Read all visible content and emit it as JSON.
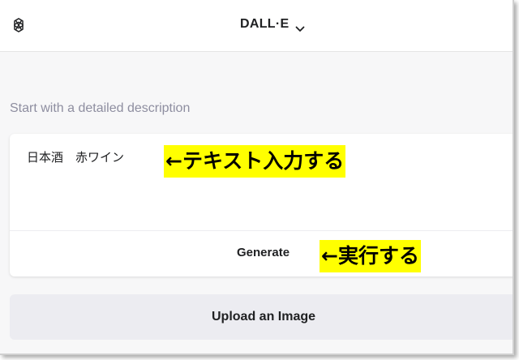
{
  "header": {
    "title": "DALL·E",
    "logo_icon": "openai-logo-icon",
    "dropdown_icon": "chevron-down-icon"
  },
  "main": {
    "hint": "Start with a detailed description",
    "prompt_value": "日本酒　赤ワイン",
    "generate_label": "Generate",
    "upload_label": "Upload an Image"
  },
  "annotations": {
    "input_note": "←テキスト入力する",
    "generate_note": "←実行する",
    "highlight_color": "#ffff00"
  }
}
